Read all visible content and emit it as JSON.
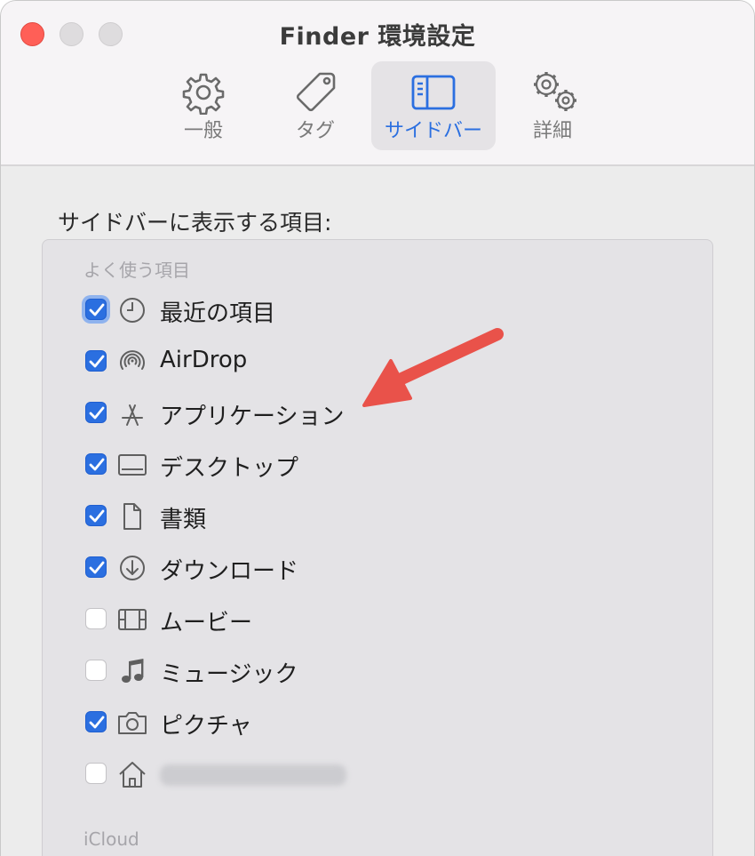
{
  "window": {
    "title": "Finder 環境設定"
  },
  "toolbar": {
    "tabs": [
      {
        "label": "一般",
        "icon": "gear-icon"
      },
      {
        "label": "タグ",
        "icon": "tag-icon"
      },
      {
        "label": "サイドバー",
        "icon": "sidebar-icon",
        "active": true
      },
      {
        "label": "詳細",
        "icon": "gears-icon"
      }
    ]
  },
  "sidebar_items": {
    "heading": "サイドバーに表示する項目:",
    "favorites_label": "よく使う項目",
    "icloud_label": "iCloud",
    "items": [
      {
        "label": "最近の項目",
        "checked": true,
        "icon": "clock-icon"
      },
      {
        "label": "AirDrop",
        "checked": true,
        "icon": "airdrop-icon"
      },
      {
        "label": "アプリケーション",
        "checked": true,
        "icon": "applications-icon"
      },
      {
        "label": "デスクトップ",
        "checked": true,
        "icon": "desktop-icon"
      },
      {
        "label": "書類",
        "checked": true,
        "icon": "document-icon"
      },
      {
        "label": "ダウンロード",
        "checked": true,
        "icon": "download-icon"
      },
      {
        "label": "ムービー",
        "checked": false,
        "icon": "film-icon"
      },
      {
        "label": "ミュージック",
        "checked": false,
        "icon": "music-note-icon"
      },
      {
        "label": "ピクチャ",
        "checked": true,
        "icon": "camera-icon"
      },
      {
        "label": "",
        "checked": false,
        "icon": "home-icon",
        "redacted": true
      }
    ]
  },
  "colors": {
    "accent": "#2b6fe0",
    "close": "#ff5f57",
    "annotation": "#e9524a"
  }
}
